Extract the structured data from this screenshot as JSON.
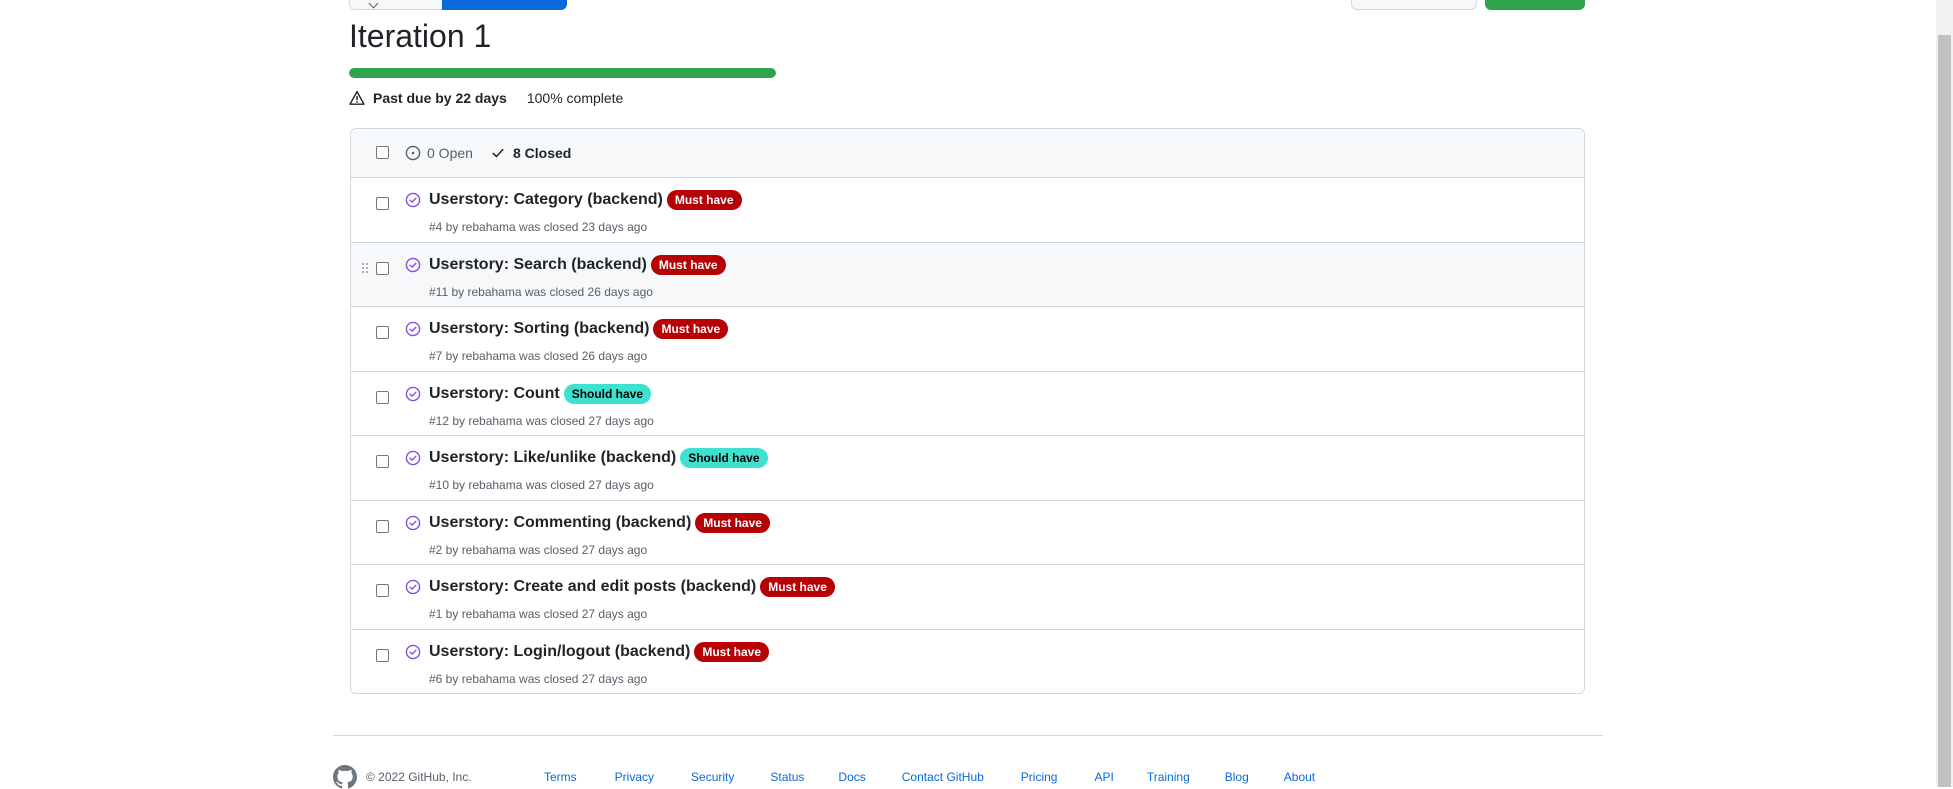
{
  "milestone": {
    "title": "Iteration 1",
    "progress_percent": 100,
    "due_status": "Past due by 22 days",
    "complete_text": "100% complete"
  },
  "filters": {
    "open_label": "0 Open",
    "closed_label": "8 Closed"
  },
  "issues": [
    {
      "title": "Userstory: Category (backend)",
      "label": "Must have",
      "meta": "#4 by rebahama was closed 23 days ago"
    },
    {
      "title": "Userstory: Search (backend)",
      "label": "Must have",
      "meta": "#11 by rebahama was closed 26 days ago"
    },
    {
      "title": "Userstory: Sorting (backend)",
      "label": "Must have",
      "meta": "#7 by rebahama was closed 26 days ago"
    },
    {
      "title": "Userstory: Count",
      "label": "Should have",
      "meta": "#12 by rebahama was closed 27 days ago"
    },
    {
      "title": "Userstory: Like/unlike (backend)",
      "label": "Should have",
      "meta": "#10 by rebahama was closed 27 days ago"
    },
    {
      "title": "Userstory: Commenting (backend)",
      "label": "Must have",
      "meta": "#2 by rebahama was closed 27 days ago"
    },
    {
      "title": "Userstory: Create and edit posts (backend)",
      "label": "Must have",
      "meta": "#1 by rebahama was closed 27 days ago"
    },
    {
      "title": "Userstory: Login/logout (backend)",
      "label": "Must have",
      "meta": "#6 by rebahama was closed 27 days ago"
    }
  ],
  "label_colors": {
    "must_have_bg": "#b60205",
    "must_have_fg": "#ffffff",
    "should_have_bg": "#40e0d0",
    "should_have_fg": "#000000"
  },
  "closed_icon_color": "#8250df",
  "footer": {
    "copyright": "© 2022 GitHub, Inc.",
    "links": [
      "Terms",
      "Privacy",
      "Security",
      "Status",
      "Docs",
      "Contact GitHub",
      "Pricing",
      "API",
      "Training",
      "Blog",
      "About"
    ]
  }
}
